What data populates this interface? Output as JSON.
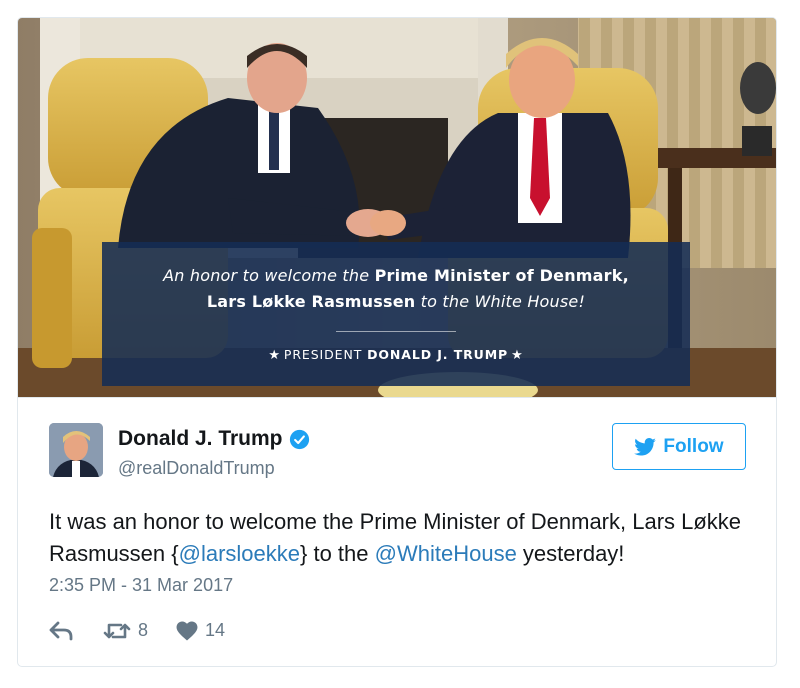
{
  "photo_banner": {
    "line1_pre": "An honor to welcome the ",
    "line1_bold": "Prime Minister of Denmark,",
    "line2_bold": "Lars Løkke Rasmussen",
    "line2_post": " to the White House!",
    "signature_pre": "PRESIDENT ",
    "signature_bold": "DONALD J. TRUMP",
    "star_glyph": "★"
  },
  "author": {
    "name": "Donald J. Trump",
    "handle": "@realDonaldTrump",
    "verified": true
  },
  "follow_button": {
    "label": "Follow"
  },
  "tweet": {
    "text_1": "It was an honor to welcome the Prime Minister of Denmark, Lars Løkke Rasmussen {",
    "mention_1": "@larsloekke",
    "text_2": "} to the ",
    "mention_2": "@WhiteHouse",
    "text_3": " yesterday!",
    "timestamp": "2:35 PM - 31 Mar 2017"
  },
  "actions": {
    "retweet_count": "8",
    "like_count": "14"
  },
  "colors": {
    "link": "#2b7bb9",
    "twitter_blue": "#1da1f2",
    "muted": "#657786",
    "banner": "#142c54"
  },
  "icons": [
    "reply-icon",
    "retweet-icon",
    "heart-icon",
    "verified-icon",
    "twitter-bird-icon"
  ]
}
